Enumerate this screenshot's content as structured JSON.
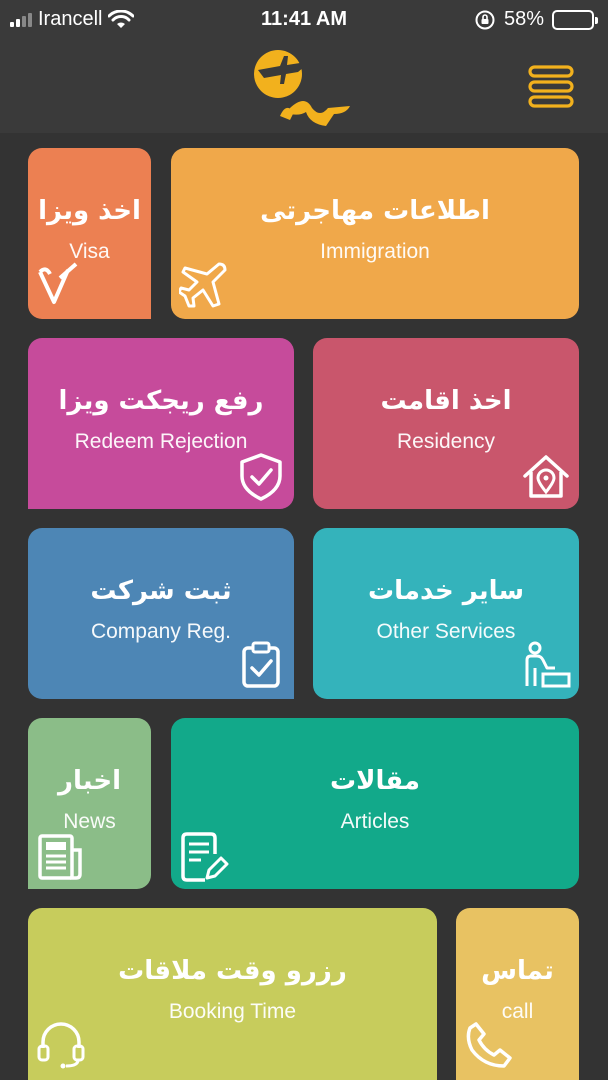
{
  "status": {
    "carrier": "Irancell",
    "time": "11:41 AM",
    "battery": "58%",
    "battery_level": 0.58
  },
  "header": {
    "logo_icon": "airplane-logo",
    "menu_icon": "menu-icon"
  },
  "tiles": {
    "visa": {
      "fa": "اخذ ویزا",
      "en": "Visa",
      "color": "#ec8052"
    },
    "immigration": {
      "fa": "اطلاعات مهاجرتی",
      "en": "Immigration",
      "color": "#f0a84a"
    },
    "redeem": {
      "fa": "رفع ریجکت ویزا",
      "en": "Redeem Rejection",
      "color": "#c64b9b"
    },
    "residency": {
      "fa": "اخذ اقامت",
      "en": "Residency",
      "color": "#c9566c"
    },
    "company": {
      "fa": "ثبت شرکت",
      "en": "Company Reg.",
      "color": "#4d86b5"
    },
    "services": {
      "fa": "سایر خدمات",
      "en": "Other Services",
      "color": "#34b3bb"
    },
    "news": {
      "fa": "اخبار",
      "en": "News",
      "color": "#8bbd88"
    },
    "articles": {
      "fa": "مقالات",
      "en": "Articles",
      "color": "#12a98a"
    },
    "booking": {
      "fa": "رزرو وقت ملاقات",
      "en": "Booking Time",
      "color": "#c7cc5c"
    },
    "call": {
      "fa": "تماس",
      "en": "call",
      "color": "#e8c262"
    }
  }
}
